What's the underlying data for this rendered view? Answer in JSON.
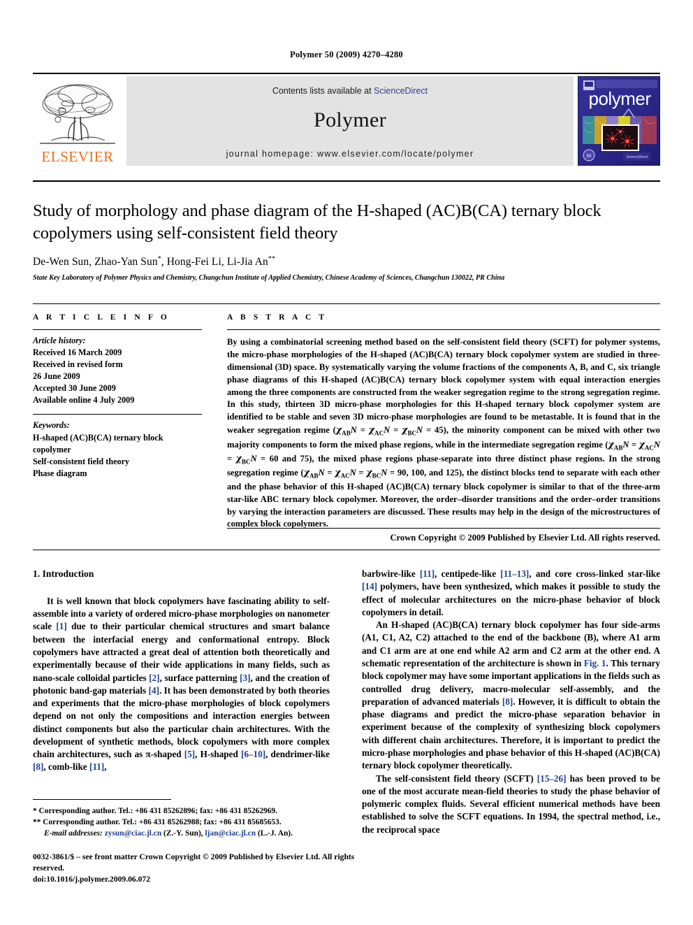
{
  "running_head": "Polymer 50 (2009) 4270–4280",
  "masthead": {
    "publisher_name": "ELSEVIER",
    "contents_prefix": "Contents lists available at ",
    "contents_link": "ScienceDirect",
    "journal_title": "Polymer",
    "homepage": "journal homepage: www.elsevier.com/locate/polymer",
    "cover_wordmark": "polymer"
  },
  "article": {
    "title": "Study of morphology and phase diagram of the H-shaped (AC)B(CA) ternary block copolymers using self-consistent field theory",
    "authors_html": "De-Wen Sun, Zhao-Yan Sun<sup>*</sup>, Hong-Fei Li, Li-Jia An<sup>**</sup>",
    "affiliation": "State Key Laboratory of Polymer Physics and Chemistry, Changchun Institute of Applied Chemistry, Chinese Academy of Sciences, Changchun 130022, PR China"
  },
  "article_info": {
    "heading": "A R T I C L E    I N F O",
    "history_label": "Article history:",
    "history": [
      "Received 16 March 2009",
      "Received in revised form",
      "26 June 2009",
      "Accepted 30 June 2009",
      "Available online 4 July 2009"
    ],
    "keywords_label": "Keywords:",
    "keywords": [
      "H-shaped (AC)B(CA) ternary block",
      "copolymer",
      "Self-consistent field theory",
      "Phase diagram"
    ]
  },
  "abstract": {
    "heading": "A B S T R A C T",
    "text_html": "By using a combinatorial screening method based on the self-consistent field theory (SCFT) for polymer systems, the micro-phase morphologies of the H-shaped (AC)B(CA) ternary block copolymer system are studied in three-dimensional (3D) space. By systematically varying the volume fractions of the components A, B, and C, six triangle phase diagrams of this H-shaped (AC)B(CA) ternary block copolymer system with equal interaction energies among the three components are constructed from the weaker segregation regime to the strong segregation regime. In this study, thirteen 3D micro-phase morphologies for this H-shaped ternary block copolymer system are identified to be stable and seven 3D micro-phase morphologies are found to be metastable. It is found that in the weaker segregation regime (<span class=\"chi\">χ</span><sub>AB</sub><i>N</i> = <span class=\"chi\">χ</span><sub>AC</sub><i>N</i> = <span class=\"chi\">χ</span><sub>BC</sub><i>N</i> = 45), the minority component can be mixed with other two majority components to form the mixed phase regions, while in the intermediate segregation regime (<span class=\"chi\">χ</span><sub>AB</sub><i>N</i> = <span class=\"chi\">χ</span><sub>AC</sub><i>N</i> = <span class=\"chi\">χ</span><sub>BC</sub><i>N</i> = 60 and 75), the mixed phase regions phase-separate into three distinct phase regions. In the strong segregation regime (<span class=\"chi\">χ</span><sub>AB</sub><i>N</i> = <span class=\"chi\">χ</span><sub>AC</sub><i>N</i> = <span class=\"chi\">χ</span><sub>BC</sub><i>N</i> = 90, 100, and 125), the distinct blocks tend to separate with each other and the phase behavior of this H-shaped (AC)B(CA) ternary block copolymer is similar to that of the three-arm star-like ABC ternary block copolymer. Moreover, the order–disorder transitions and the order–order transitions by varying the interaction parameters are discussed. These results may help in the design of the microstructures of complex block copolymers.",
    "copyright": "Crown Copyright © 2009 Published by Elsevier Ltd. All rights reserved."
  },
  "introduction": {
    "heading": "1. Introduction",
    "left_html": "It is well known that block copolymers have fascinating ability to self-assemble into a variety of ordered micro-phase morphologies on nanometer scale <span class=\"ref\">[1]</span> due to their particular chemical structures and smart balance between the interfacial energy and conformational entropy. Block copolymers have attracted a great deal of attention both theoretically and experimentally because of their wide applications in many fields, such as nano-scale colloidal particles <span class=\"ref\">[2]</span>, surface patterning <span class=\"ref\">[3]</span>, and the creation of photonic band-gap materials <span class=\"ref\">[4]</span>. It has been demonstrated by both theories and experiments that the micro-phase morphologies of block copolymers depend on not only the compositions and interaction energies between distinct components but also the particular chain architectures. With the development of synthetic methods, block copolymers with more complex chain architectures, such as π-shaped <span class=\"ref\">[5]</span>, H-shaped <span class=\"ref\">[6–10]</span>, dendrimer-like <span class=\"ref\">[8]</span>, comb-like <span class=\"ref\">[11]</span>,",
    "right_paragraphs_html": [
      "barbwire-like <span class=\"ref\">[11]</span>, centipede-like <span class=\"ref\">[11–13]</span>, and core cross-linked star-like <span class=\"ref\">[14]</span> polymers, have been synthesized, which makes it possible to study the effect of molecular architectures on the micro-phase behavior of block copolymers in detail.",
      "An H-shaped (AC)B(CA) ternary block copolymer has four side-arms (A1, C1, A2, C2) attached to the end of the backbone (B), where A1 arm and C1 arm are at one end while A2 arm and C2 arm at the other end. A schematic representation of the architecture is shown in <span class=\"ref\">Fig. 1</span>. This ternary block copolymer may have some important applications in the fields such as controlled drug delivery, macro-molecular self-assembly, and the preparation of advanced materials <span class=\"ref\">[8]</span>. However, it is difficult to obtain the phase diagrams and predict the micro-phase separation behavior in experiment because of the complexity of synthesizing block copolymers with different chain architectures. Therefore, it is important to predict the micro-phase morphologies and phase behavior of this H-shaped (AC)B(CA) ternary block copolymer theoretically.",
      "The self-consistent field theory (SCFT) <span class=\"ref\">[15–26]</span> has been proved to be one of the most accurate mean-field theories to study the phase behavior of polymeric complex fluids. Several efficient numerical methods have been established to solve the SCFT equations. In 1994, the spectral method, i.e., the reciprocal space"
    ]
  },
  "footnotes": {
    "corresponding_1": "* Corresponding author. Tel.: +86 431 85262896; fax: +86 431 85262969.",
    "corresponding_2": "** Corresponding author. Tel.: +86 431 85262988; fax: +86 431 85685653.",
    "email_label": "E-mail addresses:",
    "email_1": "zysun@ciac.jl.cn",
    "email_1_owner": "(Z.-Y. Sun),",
    "email_2": "ljan@ciac.jl.cn",
    "email_2_owner": "(L.-J. An)."
  },
  "imprint": {
    "line1": "0032-3861/$ – see front matter Crown Copyright © 2009 Published by Elsevier Ltd. All rights reserved.",
    "line2": "doi:10.1016/j.polymer.2009.06.072"
  },
  "colors": {
    "link": "#1f3f8f",
    "sciencedirect": "#3a3a8c",
    "elsevier_orange": "#E9711C",
    "cover_blue": "#2b2a8c",
    "band_gray": "#e3e3e3"
  }
}
